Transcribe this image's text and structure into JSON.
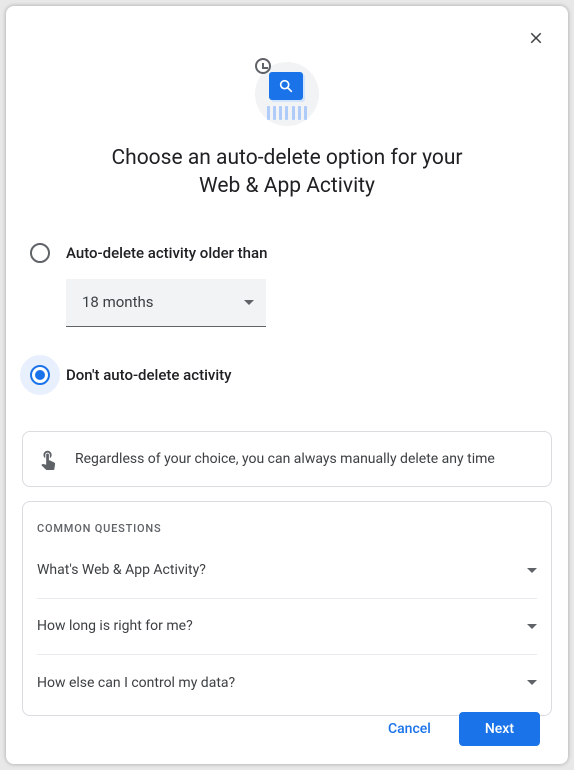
{
  "title_line1": "Choose an auto-delete option for your",
  "title_line2": "Web & App Activity",
  "options": {
    "auto_delete": {
      "label": "Auto-delete activity older than",
      "selected": false,
      "dropdown_value": "18 months"
    },
    "dont_delete": {
      "label": "Don't auto-delete activity",
      "selected": true
    }
  },
  "info_text": "Regardless of your choice, you can always manually delete any time",
  "faq": {
    "heading": "COMMON QUESTIONS",
    "items": [
      "What's Web & App Activity?",
      "How long is right for me?",
      "How else can I control my data?"
    ]
  },
  "buttons": {
    "cancel": "Cancel",
    "next": "Next"
  }
}
